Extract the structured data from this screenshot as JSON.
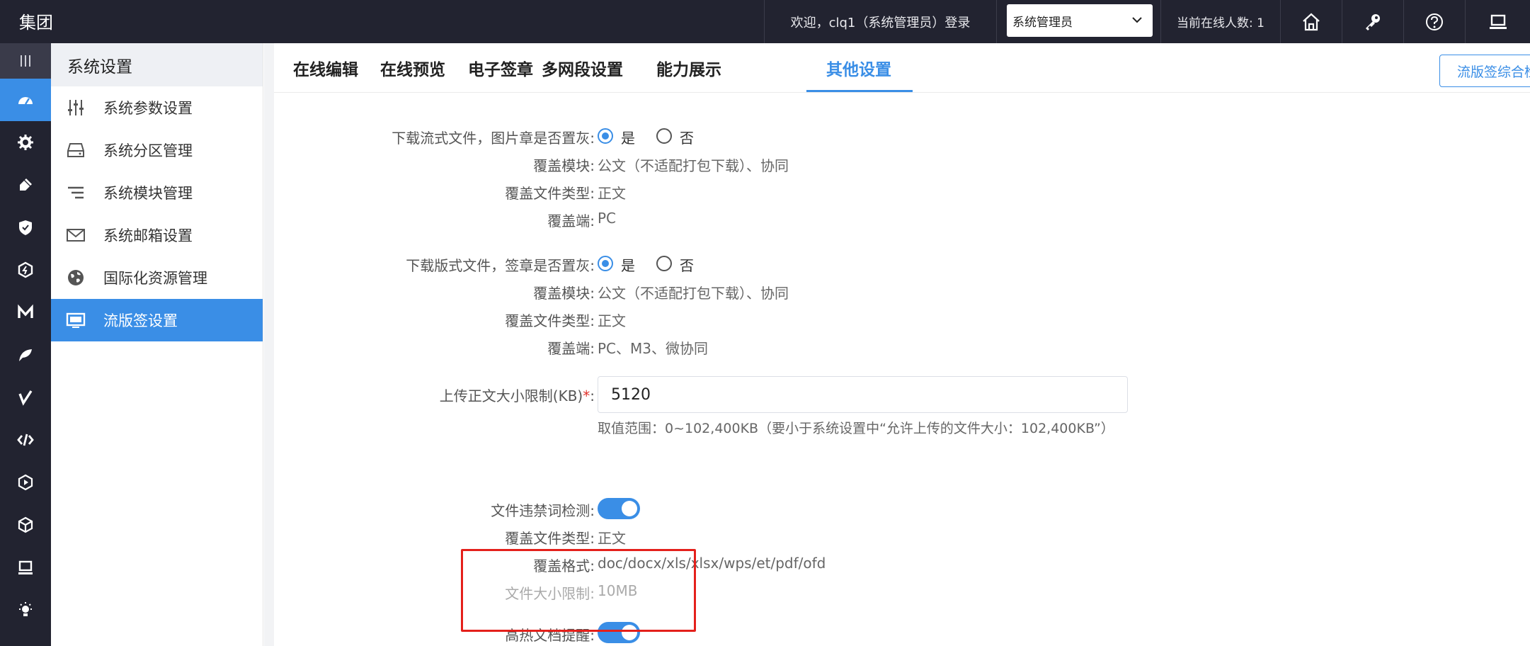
{
  "header": {
    "brand": "集团",
    "welcome": "欢迎，clq1（系统管理员）登录",
    "role_selected": "系统管理员",
    "online": "当前在线人数: 1",
    "icons": [
      "home-icon",
      "key-icon",
      "help-icon",
      "screen-icon"
    ]
  },
  "rail": {
    "icons": [
      "menu-icon",
      "dashboard-icon",
      "settings-icon",
      "plugin-icon",
      "shield-icon",
      "hexagon-icon",
      "m-icon",
      "leaf-icon",
      "check-icon",
      "code-icon",
      "play-icon",
      "cube-icon",
      "monitor-icon",
      "bulb-icon"
    ]
  },
  "sidebar": {
    "title": "系统设置",
    "items": [
      {
        "label": "系统参数设置",
        "icon": "sliders-icon"
      },
      {
        "label": "系统分区管理",
        "icon": "drive-icon"
      },
      {
        "label": "系统模块管理",
        "icon": "list-icon"
      },
      {
        "label": "系统邮箱设置",
        "icon": "mail-icon"
      },
      {
        "label": "国际化资源管理",
        "icon": "globe-icon"
      },
      {
        "label": "流版签设置",
        "icon": "monitor-icon"
      }
    ]
  },
  "tabs": [
    "在线编辑",
    "在线预览",
    "电子签章",
    "多网段设置",
    "能力展示",
    "其他设置"
  ],
  "active_tab": "其他设置",
  "top_button": "流版签综合检",
  "form": {
    "stream_gray": {
      "label": "下载流式文件，图片章是否置灰:",
      "yes": "是",
      "no": "否",
      "selected": "是",
      "modules_label": "覆盖模块:",
      "modules": "公文（不适配打包下载）、协同",
      "types_label": "覆盖文件类型:",
      "types": "正文",
      "ends_label": "覆盖端:",
      "ends": "PC"
    },
    "layout_gray": {
      "label": "下载版式文件，签章是否置灰:",
      "yes": "是",
      "no": "否",
      "selected": "是",
      "modules_label": "覆盖模块:",
      "modules": "公文（不适配打包下载）、协同",
      "types_label": "覆盖文件类型:",
      "types": "正文",
      "ends_label": "覆盖端:",
      "ends": "PC、M3、微协同"
    },
    "upload_limit": {
      "label": "上传正文大小限制(KB)",
      "required_mark": "*",
      "colon": ":",
      "value": "5120",
      "hint": "取值范围：0~102,400KB（要小于系统设置中“允许上传的文件大小：102,400KB”）"
    },
    "forbidden_words": {
      "label": "文件违禁词检测:",
      "enabled": true,
      "types_label": "覆盖文件类型:",
      "types": "正文",
      "formats_label": "覆盖格式:",
      "formats": "doc/docx/xls/xlsx/wps/et/pdf/ofd",
      "size_label": "文件大小限制:",
      "size": "10MB"
    },
    "hot_doc": {
      "label": "高热文档提醒:",
      "enabled": true
    }
  },
  "colors": {
    "accent": "#3a8ee6",
    "header_bg": "#222330",
    "highlight": "#e4201b"
  }
}
